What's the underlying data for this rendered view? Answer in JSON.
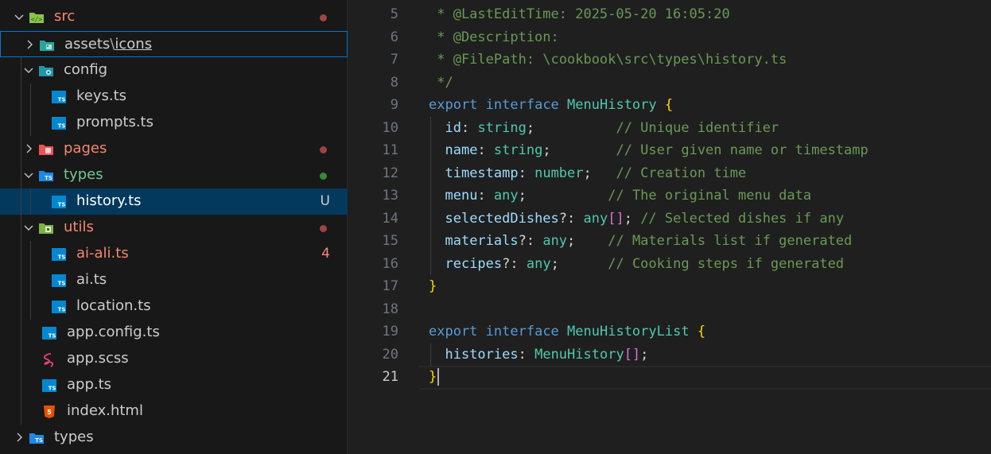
{
  "explorer": {
    "rows": [
      {
        "label": "src",
        "twisty": "open",
        "icon": "react-folder-icon",
        "dot": "#a1433f",
        "label_color": "#f48771"
      },
      {
        "label": "assets",
        "sub": "icons",
        "twisty": "closed",
        "icon": "image-folder-icon"
      },
      {
        "label": "config",
        "twisty": "open",
        "icon": "config-folder-icon"
      },
      {
        "label": "keys.ts",
        "icon": "typescript-file-icon"
      },
      {
        "label": "prompts.ts",
        "icon": "typescript-file-icon"
      },
      {
        "label": "pages",
        "twisty": "closed",
        "icon": "pages-folder-icon",
        "dot": "#a1433f",
        "label_color": "#f48771"
      },
      {
        "label": "types",
        "twisty": "open",
        "icon": "ts-folder-icon",
        "dot": "#388a34",
        "label_color": "#73c991"
      },
      {
        "label": "history.ts",
        "icon": "typescript-file-icon",
        "badge": "U",
        "label_color": "#ffffff"
      },
      {
        "label": "utils",
        "twisty": "open",
        "icon": "utils-folder-icon",
        "dot": "#a1433f",
        "label_color": "#f48771"
      },
      {
        "label": "ai-ali.ts",
        "icon": "typescript-file-icon",
        "badge": "4",
        "label_color": "#f48771"
      },
      {
        "label": "ai.ts",
        "icon": "typescript-file-icon"
      },
      {
        "label": "location.ts",
        "icon": "typescript-file-icon"
      },
      {
        "label": "app.config.ts",
        "icon": "typescript-file-icon"
      },
      {
        "label": "app.scss",
        "icon": "sass-file-icon"
      },
      {
        "label": "app.ts",
        "icon": "typescript-file-icon"
      },
      {
        "label": "index.html",
        "icon": "html-file-icon"
      },
      {
        "label": "types",
        "twisty": "closed",
        "icon": "ts-folder-icon"
      }
    ]
  },
  "editor": {
    "active_line": "21",
    "lines": [
      {
        "n": "5",
        "tokens": [
          [
            "c",
            " * @LastEditTime: 2025-05-20 16:05:20"
          ]
        ]
      },
      {
        "n": "6",
        "tokens": [
          [
            "c",
            " * @Description:"
          ]
        ]
      },
      {
        "n": "7",
        "tokens": [
          [
            "c",
            " * @FilePath: \\cookbook\\src\\types\\history.ts"
          ]
        ]
      },
      {
        "n": "8",
        "tokens": [
          [
            "c",
            " */"
          ]
        ]
      },
      {
        "n": "9",
        "tokens": [
          [
            "k",
            "export"
          ],
          [
            "p",
            " "
          ],
          [
            "k",
            "interface"
          ],
          [
            "p",
            " "
          ],
          [
            "t",
            "MenuHistory"
          ],
          [
            "p",
            " "
          ],
          [
            "b1",
            "{"
          ]
        ]
      },
      {
        "n": "10",
        "tokens": [
          [
            "p",
            "  "
          ],
          [
            "v",
            "id"
          ],
          [
            "p",
            ": "
          ],
          [
            "t",
            "string"
          ],
          [
            "p",
            ";          "
          ],
          [
            "c",
            "// Unique identifier"
          ]
        ]
      },
      {
        "n": "11",
        "tokens": [
          [
            "p",
            "  "
          ],
          [
            "v",
            "name"
          ],
          [
            "p",
            ": "
          ],
          [
            "t",
            "string"
          ],
          [
            "p",
            ";        "
          ],
          [
            "c",
            "// User given name or timestamp"
          ]
        ]
      },
      {
        "n": "12",
        "tokens": [
          [
            "p",
            "  "
          ],
          [
            "v",
            "timestamp"
          ],
          [
            "p",
            ": "
          ],
          [
            "t",
            "number"
          ],
          [
            "p",
            ";   "
          ],
          [
            "c",
            "// Creation time"
          ]
        ]
      },
      {
        "n": "13",
        "tokens": [
          [
            "p",
            "  "
          ],
          [
            "v",
            "menu"
          ],
          [
            "p",
            ": "
          ],
          [
            "t",
            "any"
          ],
          [
            "p",
            ";          "
          ],
          [
            "c",
            "// The original menu data"
          ]
        ]
      },
      {
        "n": "14",
        "tokens": [
          [
            "p",
            "  "
          ],
          [
            "v",
            "selectedDishes"
          ],
          [
            "p",
            "?: "
          ],
          [
            "t",
            "any"
          ],
          [
            "b2",
            "[]"
          ],
          [
            "p",
            "; "
          ],
          [
            "c",
            "// Selected dishes if any"
          ]
        ]
      },
      {
        "n": "15",
        "tokens": [
          [
            "p",
            "  "
          ],
          [
            "v",
            "materials"
          ],
          [
            "p",
            "?: "
          ],
          [
            "t",
            "any"
          ],
          [
            "p",
            ";    "
          ],
          [
            "c",
            "// Materials list if generated"
          ]
        ]
      },
      {
        "n": "16",
        "tokens": [
          [
            "p",
            "  "
          ],
          [
            "v",
            "recipes"
          ],
          [
            "p",
            "?: "
          ],
          [
            "t",
            "any"
          ],
          [
            "p",
            ";      "
          ],
          [
            "c",
            "// Cooking steps if generated"
          ]
        ]
      },
      {
        "n": "17",
        "tokens": [
          [
            "b1",
            "}"
          ]
        ]
      },
      {
        "n": "18",
        "tokens": []
      },
      {
        "n": "19",
        "tokens": [
          [
            "k",
            "export"
          ],
          [
            "p",
            " "
          ],
          [
            "k",
            "interface"
          ],
          [
            "p",
            " "
          ],
          [
            "t",
            "MenuHistoryList"
          ],
          [
            "p",
            " "
          ],
          [
            "b1",
            "{"
          ]
        ]
      },
      {
        "n": "20",
        "tokens": [
          [
            "p",
            "  "
          ],
          [
            "v",
            "histories"
          ],
          [
            "p",
            ": "
          ],
          [
            "t",
            "MenuHistory"
          ],
          [
            "b2",
            "[]"
          ],
          [
            "p",
            ";"
          ]
        ]
      },
      {
        "n": "21",
        "tokens": [
          [
            "b1",
            "}"
          ]
        ]
      }
    ]
  }
}
